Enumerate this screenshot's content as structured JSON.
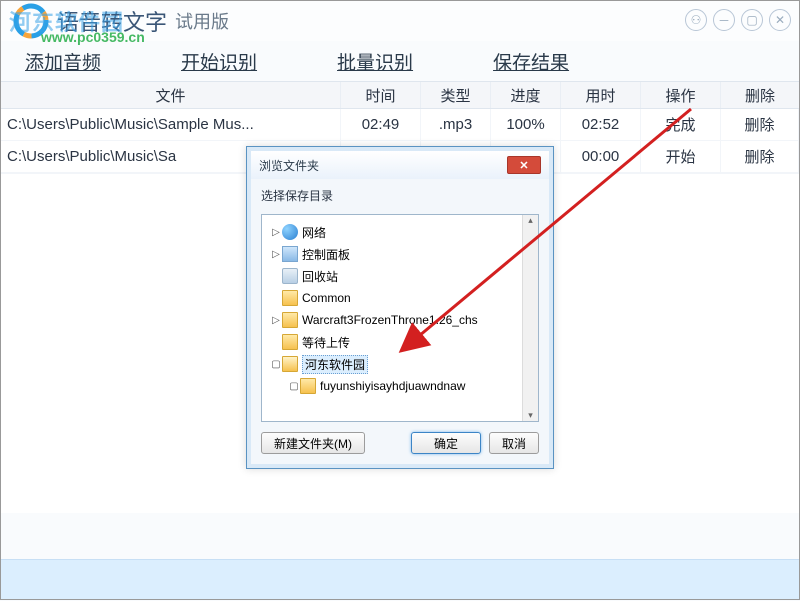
{
  "watermark": {
    "brand": "河东软件园",
    "url": "www.pc0359.cn"
  },
  "titlebar": {
    "main": "语音转文字",
    "sub": "试用版"
  },
  "toolbar": [
    "添加音频",
    "开始识别",
    "批量识别",
    "保存结果"
  ],
  "columns": [
    "文件",
    "时间",
    "类型",
    "进度",
    "用时",
    "操作",
    "删除"
  ],
  "rows": [
    {
      "file": "C:\\Users\\Public\\Music\\Sample Mus...",
      "time": "02:49",
      "type": ".mp3",
      "prog": "100%",
      "dur": "02:52",
      "op": "完成",
      "del": "删除"
    },
    {
      "file": "C:\\Users\\Public\\Music\\Sa",
      "time": "",
      "type": "",
      "prog": "",
      "dur": "00:00",
      "op": "开始",
      "del": "删除"
    }
  ],
  "dialog": {
    "title": "浏览文件夹",
    "label": "选择保存目录",
    "tree": [
      {
        "indent": 0,
        "twisty": "▷",
        "icon": "net-icon",
        "text": "网络"
      },
      {
        "indent": 0,
        "twisty": "▷",
        "icon": "cp-icon",
        "text": "控制面板"
      },
      {
        "indent": 0,
        "twisty": "",
        "icon": "bin-icon",
        "text": "回收站"
      },
      {
        "indent": 0,
        "twisty": "",
        "icon": "folder",
        "text": "Common"
      },
      {
        "indent": 0,
        "twisty": "▷",
        "icon": "folder",
        "text": "Warcraft3FrozenThrone1.26_chs"
      },
      {
        "indent": 0,
        "twisty": "",
        "icon": "folder",
        "text": "等待上传"
      },
      {
        "indent": 0,
        "twisty": "▢",
        "icon": "folder-open",
        "text": "河东软件园",
        "selected": true
      },
      {
        "indent": 1,
        "twisty": "▢",
        "icon": "folder",
        "text": "fuyunshiyisayhdjuawndnaw"
      }
    ],
    "buttons": {
      "newfolder": "新建文件夹(M)",
      "ok": "确定",
      "cancel": "取消"
    }
  }
}
